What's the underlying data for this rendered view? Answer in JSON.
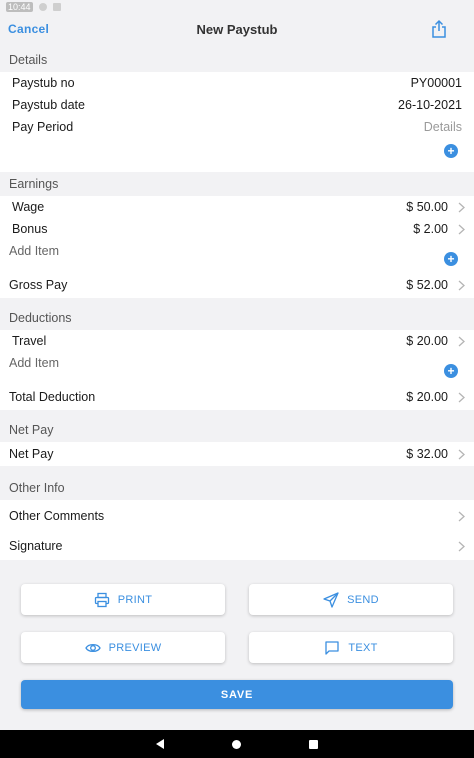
{
  "status_bar": {
    "time": "10:44"
  },
  "header": {
    "cancel_label": "Cancel",
    "title": "New Paystub"
  },
  "details": {
    "section_label": "Details",
    "rows": [
      {
        "label": "Paystub no",
        "value": "PY00001"
      },
      {
        "label": "Paystub date",
        "value": "26-10-2021"
      },
      {
        "label": "Pay Period",
        "value": "Details"
      }
    ]
  },
  "earnings": {
    "section_label": "Earnings",
    "items": [
      {
        "label": "Wage",
        "value": "$ 50.00"
      },
      {
        "label": "Bonus",
        "value": "$ 2.00"
      }
    ],
    "add_label": "Add Item",
    "total_label": "Gross Pay",
    "total_value": "$ 52.00"
  },
  "deductions": {
    "section_label": "Deductions",
    "items": [
      {
        "label": "Travel",
        "value": "$ 20.00"
      }
    ],
    "add_label": "Add Item",
    "total_label": "Total Deduction",
    "total_value": "$ 20.00"
  },
  "net_pay": {
    "section_label": "Net Pay",
    "label": "Net Pay",
    "value": "$ 32.00"
  },
  "other_info": {
    "section_label": "Other Info",
    "comments_label": "Other Comments",
    "signature_label": "Signature"
  },
  "actions": {
    "print": "PRINT",
    "send": "SEND",
    "preview": "PREVIEW",
    "text": "TEXT",
    "save": "SAVE"
  },
  "colors": {
    "accent": "#3b8fe0",
    "background": "#f2f2f4",
    "card": "#ffffff"
  }
}
